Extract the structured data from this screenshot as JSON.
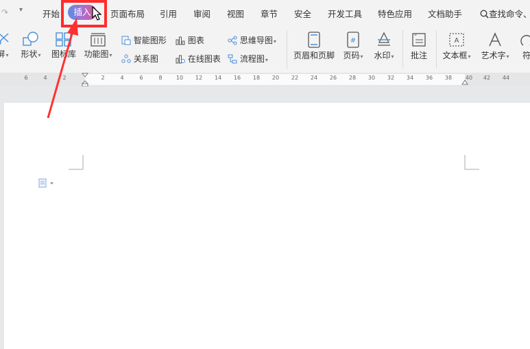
{
  "tabs": {
    "start": "开始",
    "insert": "插入",
    "page_layout": "页面布局",
    "references": "引用",
    "review": "审阅",
    "view": "视图",
    "section": "章节",
    "security": "安全",
    "dev_tools": "开发工具",
    "special_apps": "特色应用",
    "doc_assistant": "文档助手",
    "search": "查找命令、"
  },
  "ribbon": {
    "screen": "屏",
    "shape": "形状",
    "icon_lib": "图标库",
    "function_chart": "功能图",
    "smart_art": "智能图形",
    "chart": "图表",
    "mind_map": "思维导图",
    "relation": "关系图",
    "online_chart": "在线图表",
    "flowchart": "流程图",
    "header_footer": "页眉和页脚",
    "page_number": "页码",
    "watermark": "水印",
    "comment": "批注",
    "textbox": "文本框",
    "wordart": "艺术字",
    "symbol": "符"
  },
  "ruler": [
    "6",
    "4",
    "2",
    "2",
    "4",
    "6",
    "8",
    "10",
    "12",
    "14",
    "16",
    "18",
    "20",
    "22",
    "24",
    "26",
    "28",
    "30",
    "32",
    "34",
    "36",
    "38",
    "40",
    "42",
    "44"
  ],
  "colors": {
    "highlight": "#ff2c2c",
    "accent": "#5a8fe6"
  }
}
